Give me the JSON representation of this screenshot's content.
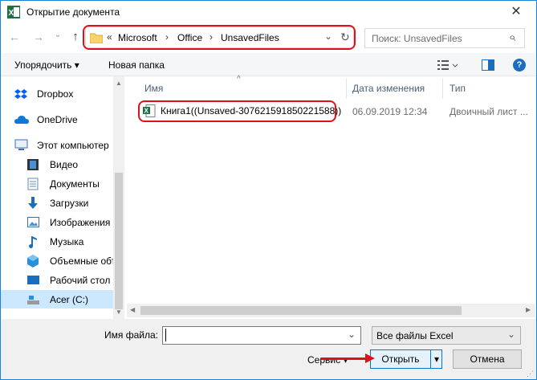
{
  "window": {
    "title": "Открытие документа",
    "close_glyph": "✕"
  },
  "nav": {
    "back_glyph": "←",
    "forward_glyph": "→",
    "dropdown_glyph": "⌄",
    "up_glyph": "↑",
    "refresh_glyph": "↻"
  },
  "address": {
    "overflow": "«",
    "crumbs": [
      "Microsoft",
      "Office",
      "UnsavedFiles"
    ],
    "separator": "›",
    "dropdown_glyph": "⌄"
  },
  "search": {
    "placeholder": "Поиск: UnsavedFiles",
    "icon_glyph": "⌕"
  },
  "toolbar": {
    "organize": "Упорядочить",
    "organize_caret": "▾",
    "new_folder": "Новая папка"
  },
  "sidebar": {
    "items": [
      {
        "label": "Dropbox",
        "icon": "dropbox-icon"
      },
      {
        "label": "OneDrive",
        "icon": "onedrive-icon"
      },
      {
        "label": "Этот компьютер",
        "icon": "computer-icon"
      },
      {
        "label": "Видео",
        "icon": "video-icon"
      },
      {
        "label": "Документы",
        "icon": "documents-icon"
      },
      {
        "label": "Загрузки",
        "icon": "downloads-icon"
      },
      {
        "label": "Изображения",
        "icon": "pictures-icon"
      },
      {
        "label": "Музыка",
        "icon": "music-icon"
      },
      {
        "label": "Объемные объ",
        "icon": "3d-objects-icon"
      },
      {
        "label": "Рабочий стол",
        "icon": "desktop-icon"
      },
      {
        "label": "Acer (C:)",
        "icon": "drive-icon"
      }
    ]
  },
  "columns": {
    "name": "Имя",
    "date": "Дата изменения",
    "type": "Тип",
    "sort_glyph": "^"
  },
  "files": [
    {
      "name": "Книга1((Unsaved-307621591850221588))",
      "date": "06.09.2019 12:34",
      "type": "Двоичный лист ..."
    }
  ],
  "bottom": {
    "filename_label": "Имя файла:",
    "filename_value": "",
    "filetype": "Все файлы Excel",
    "service": "Сервис",
    "service_caret": "▾",
    "open": "Открыть",
    "open_caret": "▾",
    "cancel": "Отмена"
  },
  "colors": {
    "highlight": "#e0101a",
    "accent": "#0078d7",
    "excel_green": "#1e7145"
  }
}
